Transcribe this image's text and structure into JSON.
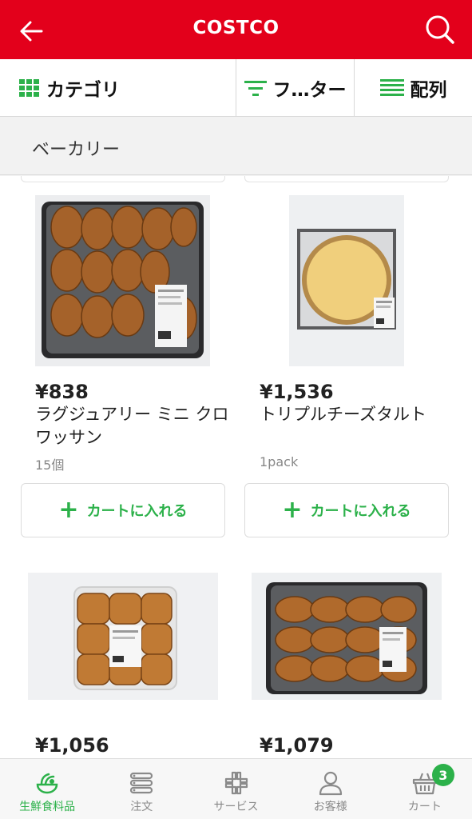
{
  "header": {
    "title": "COSTCO"
  },
  "filterbar": {
    "category_label": "カテゴリ",
    "filter_label": "フ…ター",
    "sort_label": "配列"
  },
  "category": {
    "name": "ベーカリー"
  },
  "products": [
    {
      "price": "¥838",
      "name": "ラグジュアリー ミニ クロワッサン",
      "qty": "15個",
      "cart_label": "カートに入れる",
      "thumb": "croissant-tray"
    },
    {
      "price": "¥1,536",
      "name": "トリプルチーズタルト",
      "qty": "1pack",
      "cart_label": "カートに入れる",
      "thumb": "cheese-tart"
    },
    {
      "price": "¥1,056",
      "thumb": "chocolate-croissant"
    },
    {
      "price": "¥1,079",
      "thumb": "croissant-tray-2"
    }
  ],
  "tabs": [
    {
      "label": "生鮮食料品",
      "icon": "fresh-food-icon",
      "active": true
    },
    {
      "label": "注文",
      "icon": "order-list-icon"
    },
    {
      "label": "サービス",
      "icon": "services-icon"
    },
    {
      "label": "お客様",
      "icon": "person-icon"
    },
    {
      "label": "カート",
      "icon": "cart-icon",
      "badge": "3"
    }
  ],
  "colors": {
    "brand": "#e3001b",
    "accent": "#2cb14a"
  }
}
